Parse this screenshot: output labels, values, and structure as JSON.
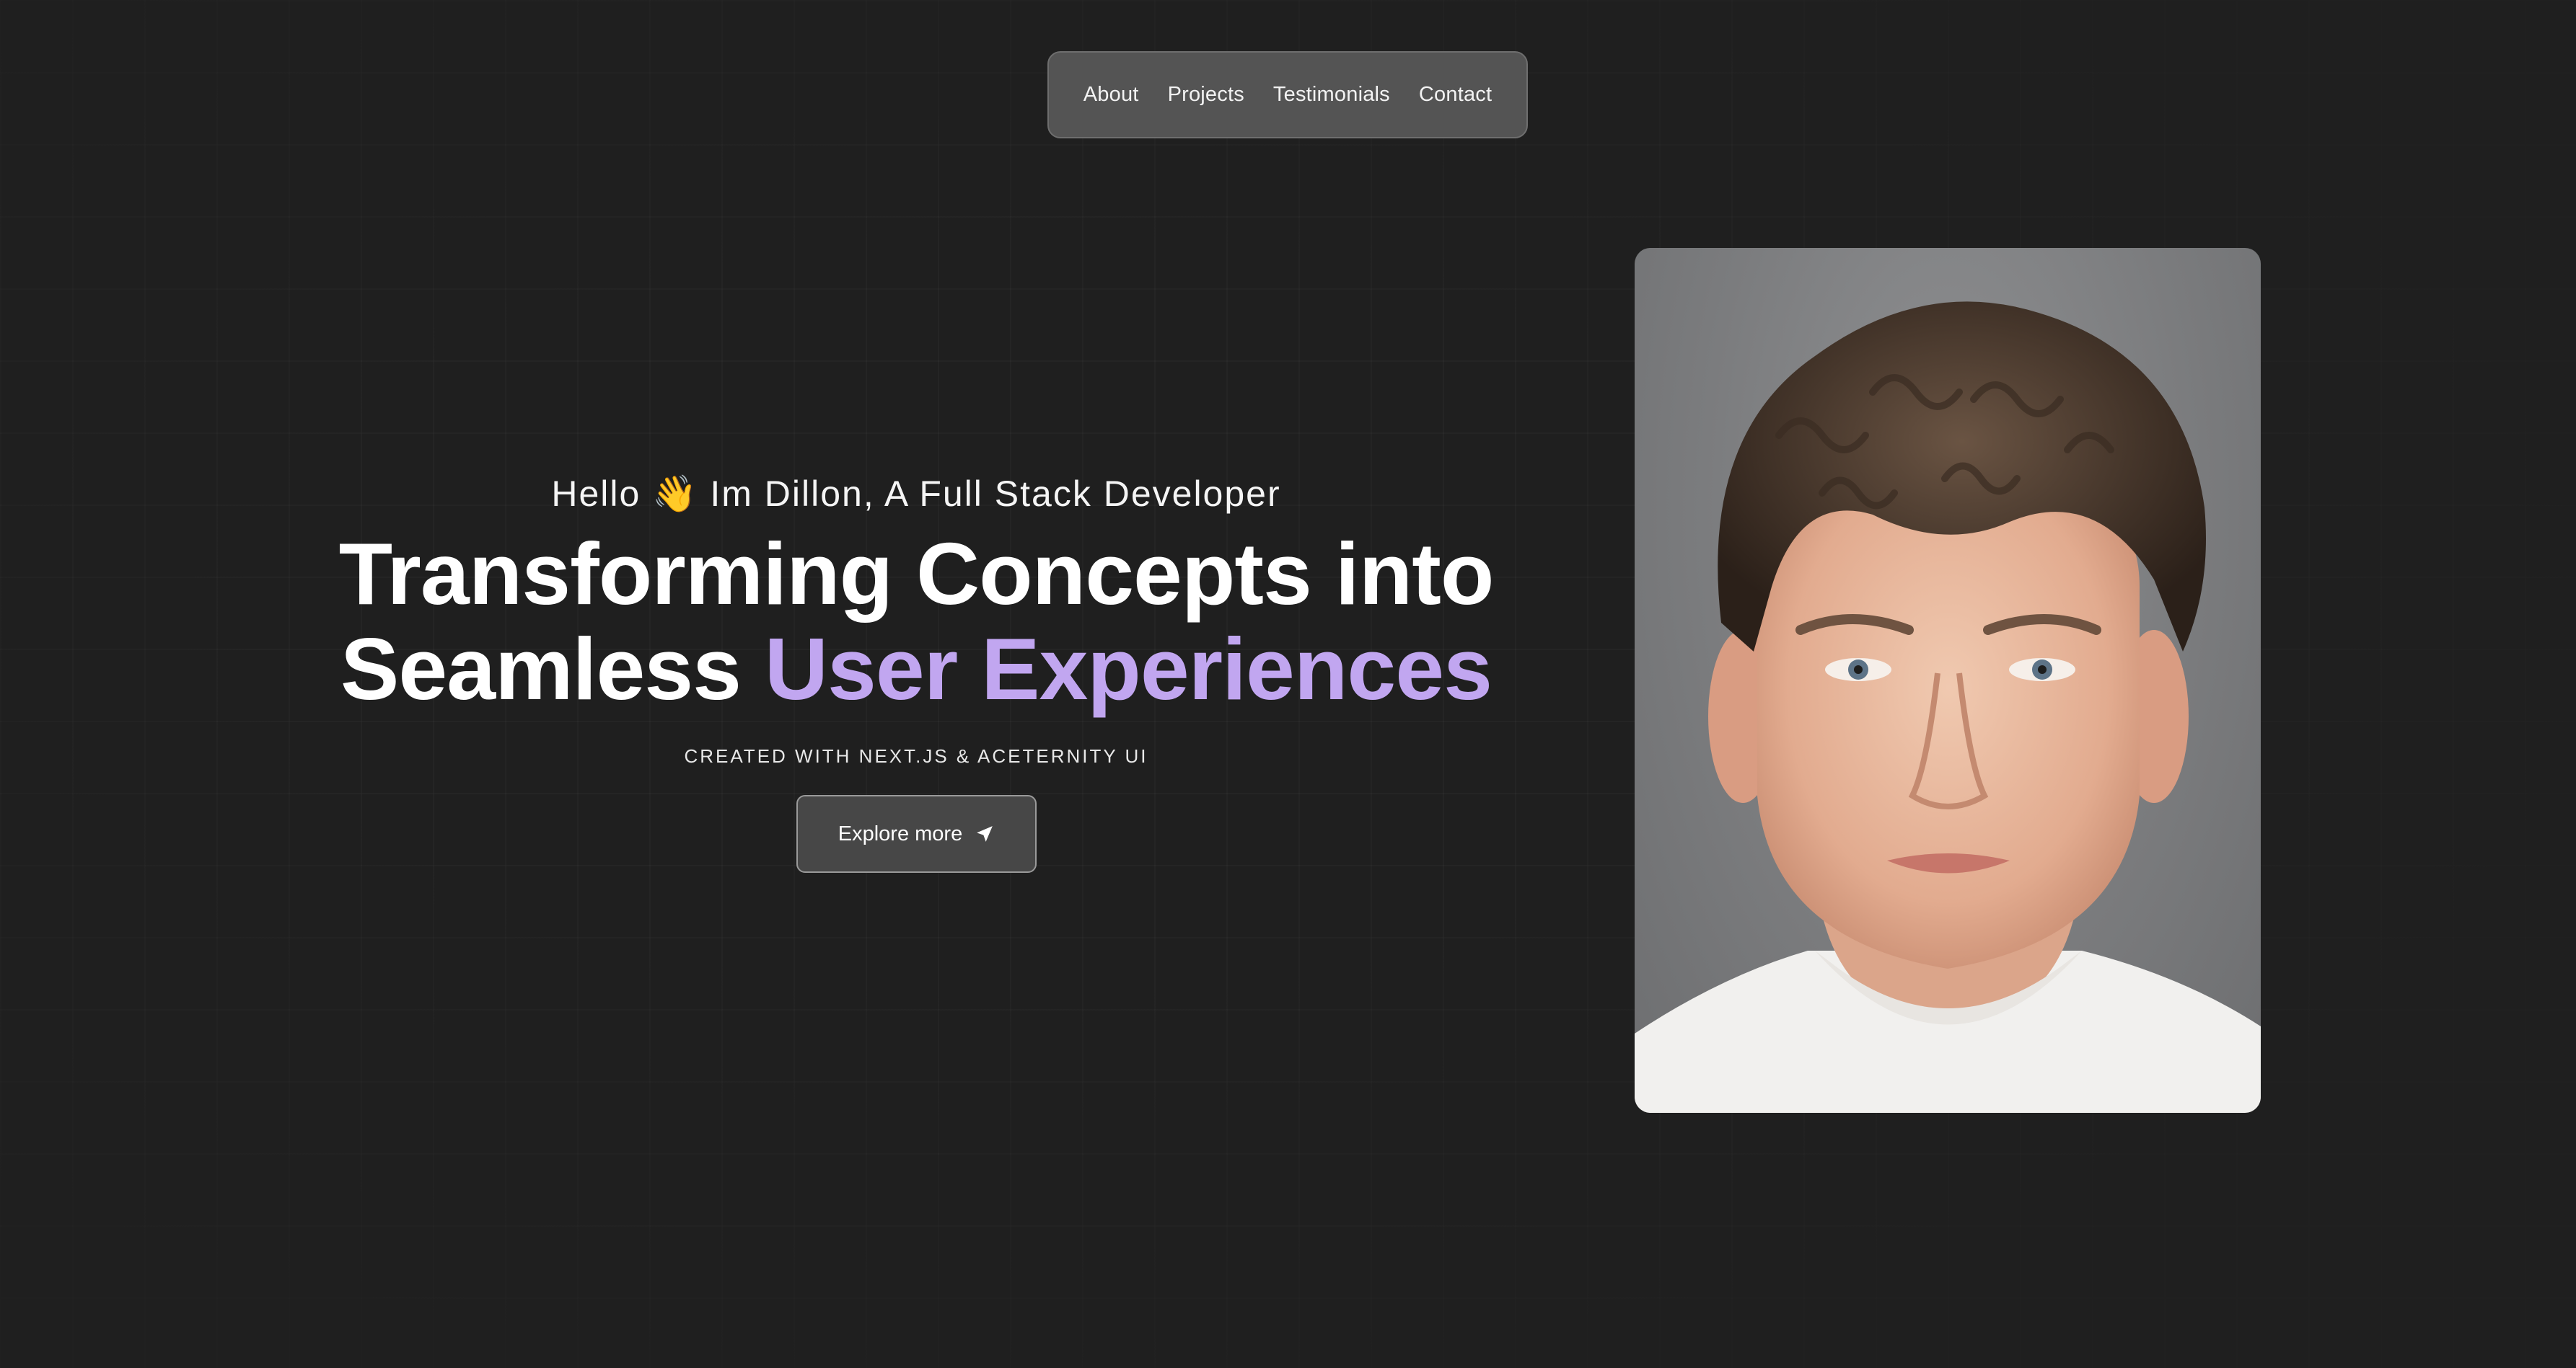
{
  "nav": {
    "items": [
      {
        "label": "About"
      },
      {
        "label": "Projects"
      },
      {
        "label": "Testimonials"
      },
      {
        "label": "Contact"
      }
    ]
  },
  "hero": {
    "greeting": "Hello 👋 Im Dillon, A Full Stack Developer",
    "headline_line1": "Transforming Concepts into",
    "headline_line2_plain": "Seamless ",
    "headline_line2_accent": "User Experiences",
    "credit": "CREATED WITH NEXT.JS & ACETERNITY UI",
    "cta_label": "Explore more",
    "cta_icon": "send-icon"
  },
  "portrait": {
    "icon": "profile-photo"
  },
  "colors": {
    "background": "#1f1f1f",
    "accent": "#c1a6f0",
    "nav_bg": "#545454",
    "button_bg": "#474747"
  }
}
